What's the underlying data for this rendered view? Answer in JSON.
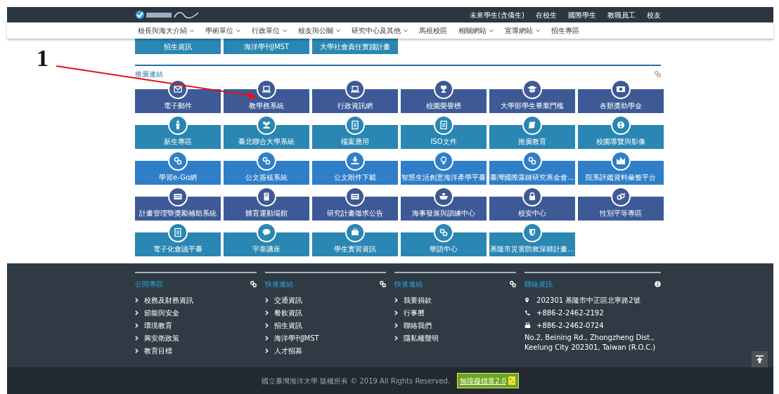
{
  "top_bar": {
    "links": [
      "未來學生(含僑生)",
      "在校生",
      "國際學生",
      "教職員工",
      "校友"
    ]
  },
  "nav": [
    {
      "label": "校長與海大介紹",
      "dropdown": true
    },
    {
      "label": "學術單位",
      "dropdown": true
    },
    {
      "label": "行政單位",
      "dropdown": true
    },
    {
      "label": "校友與公關",
      "dropdown": true
    },
    {
      "label": "研究中心及其他",
      "dropdown": true
    },
    {
      "label": "馬祖校區",
      "dropdown": false
    },
    {
      "label": "相關網站",
      "dropdown": true
    },
    {
      "label": "宣導網站",
      "dropdown": true
    },
    {
      "label": "招生專區",
      "dropdown": false
    }
  ],
  "top_buttons": [
    "招生資訊",
    "海洋學刊JMST",
    "大學社會責任實踐計畫"
  ],
  "section": {
    "title": "推廣連結"
  },
  "tiles": [
    {
      "label": "電子郵件",
      "color": "#3d5a96"
    },
    {
      "label": "教學務系統",
      "color": "#3d5a96"
    },
    {
      "label": "行政資訊網",
      "color": "#3d5a96"
    },
    {
      "label": "校園榮譽榜",
      "color": "#3d5a96"
    },
    {
      "label": "大學部學生畢業門檻",
      "color": "#3d5a96"
    },
    {
      "label": "各類獎助學金",
      "color": "#3d5a96"
    },
    {
      "label": "新生專區",
      "color": "#2a86b2"
    },
    {
      "label": "臺北聯合大學系統",
      "color": "#2a86b2"
    },
    {
      "label": "檔案應用",
      "color": "#2a86b2"
    },
    {
      "label": "ISO文件",
      "color": "#2a86b2"
    },
    {
      "label": "推廣教育",
      "color": "#2a86b2"
    },
    {
      "label": "校園導覽與影像",
      "color": "#2a86b2"
    },
    {
      "label": "學習e-Go網",
      "color": "#2f7ec8"
    },
    {
      "label": "公文簽核系統",
      "color": "#2f7ec8"
    },
    {
      "label": "公文附件下載",
      "color": "#2f7ec8"
    },
    {
      "label": "智慧生活創意海洋產學平臺",
      "color": "#2f7ec8"
    },
    {
      "label": "臺灣國際藻鏈研究基金會...",
      "color": "#2f7ec8"
    },
    {
      "label": "院系評鑑資料彙整平台",
      "color": "#2f7ec8"
    },
    {
      "label": "計畫管理暨獎勵補助系統",
      "color": "#3d5a96"
    },
    {
      "label": "體育運動場館",
      "color": "#3d5a96"
    },
    {
      "label": "研究計畫徵求公告",
      "color": "#3d5a96"
    },
    {
      "label": "海事發展與訓練中心",
      "color": "#3d5a96"
    },
    {
      "label": "校安中心",
      "color": "#3d5a96"
    },
    {
      "label": "性別平等專區",
      "color": "#3d5a96"
    },
    {
      "label": "電子化會議平臺",
      "color": "#2a86b2"
    },
    {
      "label": "宇泰講座",
      "color": "#2a86b2"
    },
    {
      "label": "學生實習資訊",
      "color": "#2a86b2"
    },
    {
      "label": "華語中心",
      "color": "#2a86b2"
    },
    {
      "label": "基隆市災害防救深耕計畫...",
      "color": "#2a86b2"
    }
  ],
  "footer": {
    "columns": [
      {
        "title": "公開專區",
        "items": [
          "校務及財務資訊",
          "節能與安全",
          "環境教育",
          "興安衛政策",
          "教育目標"
        ]
      },
      {
        "title": "快速連結",
        "items": [
          "交通資訊",
          "餐飲資訊",
          "招生資訊",
          "海洋學刊JMST",
          "人才招募"
        ]
      },
      {
        "title": "快速連結",
        "items": [
          "我要捐款",
          "行事曆",
          "聯絡我們",
          "隱私權聲明"
        ]
      }
    ],
    "contact": {
      "title": "聯絡資訊",
      "address": "202301 基隆市中正區北寧路2號",
      "phone": "+886-2-2462-2192",
      "fax": "+886-2-2462-0724",
      "address_en": "No.2, Beining Rd., Zhongzheng Dist., Keelung City 202301, Taiwan (R.O.C.)"
    }
  },
  "copyright": "國立臺灣海洋大學 版權所有 © 2019 All Rights Reserved.",
  "badge": "無障礙標章2.0",
  "annotation": {
    "label": "1"
  }
}
